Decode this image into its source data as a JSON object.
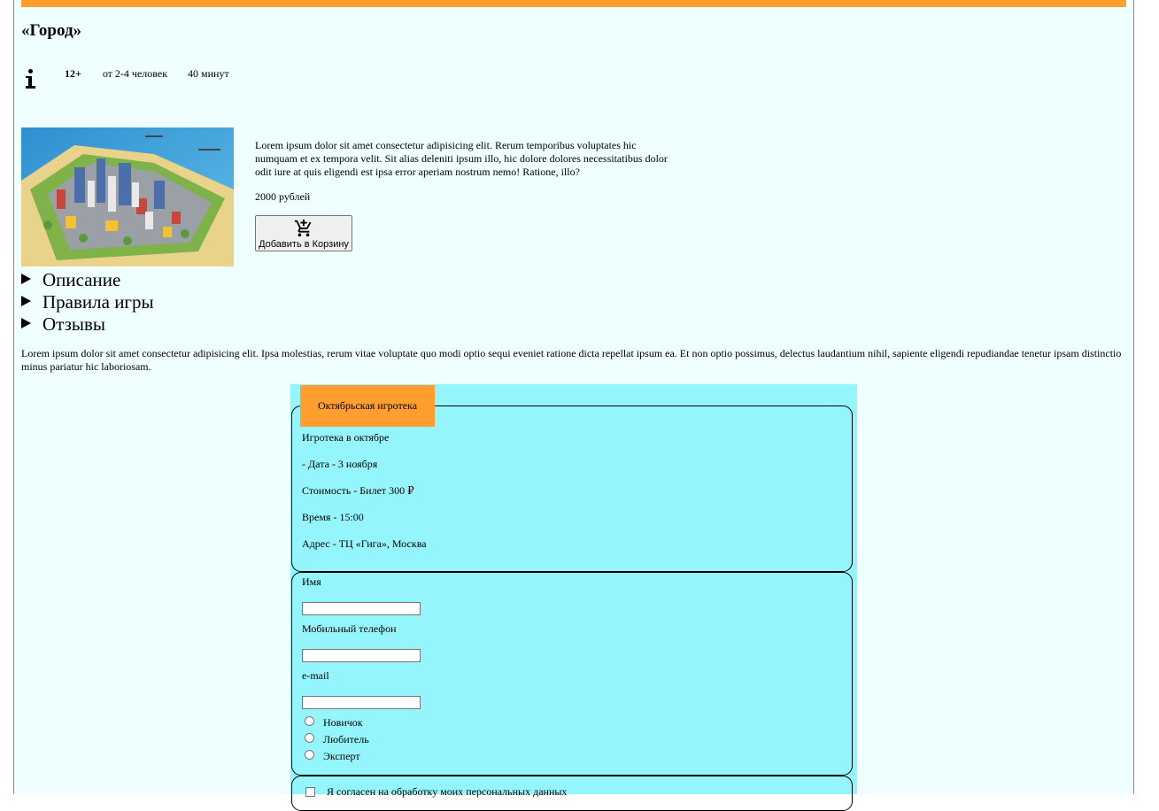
{
  "game": {
    "title": "«Город»",
    "age": "12+",
    "players": "от 2-4 человек",
    "duration": "40 минут",
    "short_description": "Lorem ipsum dolor sit amet consectetur adipisicing elit. Rerum temporibus voluptates hic numquam et ex tempora velit. Sit alias deleniti ipsum illo, hic dolore dolores necessitatibus dolor odit iure at quis eligendi est ipsa error aperiam nostrum nemo! Ratione, illo?",
    "price": "2000 рублей",
    "cart_button_label": "Добавить в Корзину",
    "long_description": "Lorem ipsum dolor sit amet consectetur adipisicing elit. Ipsa molestias, rerum vitae voluptate quo modi optio sequi eveniet ratione dicta repellat ipsum ea. Et non optio possimus, delectus laudantium nihil, sapiente eligendi repudiandae tenetur ipsam distinctio minus pariatur hic laboriosam."
  },
  "sections": [
    {
      "label": "Описание"
    },
    {
      "label": "Правила игры"
    },
    {
      "label": "Отзывы"
    }
  ],
  "event": {
    "legend": "Октябрьская игротека",
    "lines": [
      "Игротека в октябре",
      "- Дата - 3 ноября",
      "Стоимость - Билет 300 ₽",
      "Время - 15:00",
      "Адрес - ТЦ «Гига», Москва"
    ]
  },
  "form": {
    "name_label": "Имя",
    "phone_label": "Мобильный телефон",
    "email_label": "e-mail",
    "levels": [
      "Новичок",
      "Любитель",
      "Эксперт"
    ],
    "consent_label": "Я согласен на обработку моих персональных данных"
  },
  "colors": {
    "accent": "#ff9e2e",
    "page_bg": "#efffff",
    "form_bg": "#95f5fd"
  },
  "icons": {
    "info": "info-icon",
    "cart": "add-cart-icon",
    "disclosure": "triangle-right-icon"
  }
}
